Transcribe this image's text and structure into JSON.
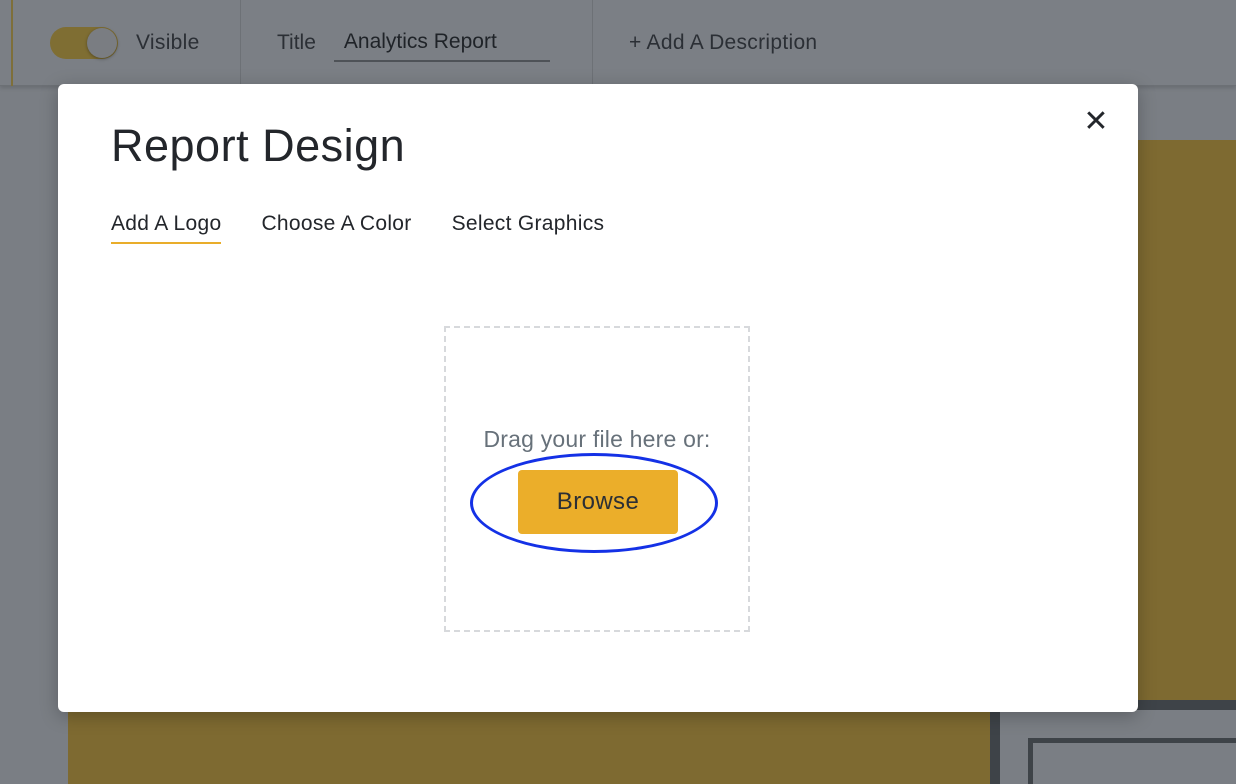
{
  "topbar": {
    "visible_label": "Visible",
    "visible_toggle_on": true,
    "title_label": "Title",
    "title_value": "Analytics Report",
    "add_description_label": "+ Add A Description"
  },
  "modal": {
    "title": "Report Design",
    "close_icon": "close-icon",
    "tabs": [
      {
        "label": "Add A Logo",
        "active": true
      },
      {
        "label": "Choose A Color",
        "active": false
      },
      {
        "label": "Select Graphics",
        "active": false
      }
    ],
    "dropzone": {
      "prompt": "Drag your file here or:",
      "browse_label": "Browse"
    }
  },
  "colors": {
    "accent": "#ebae2a",
    "highlight": "#1431e6",
    "overlay_gold": "#7e6a31"
  }
}
